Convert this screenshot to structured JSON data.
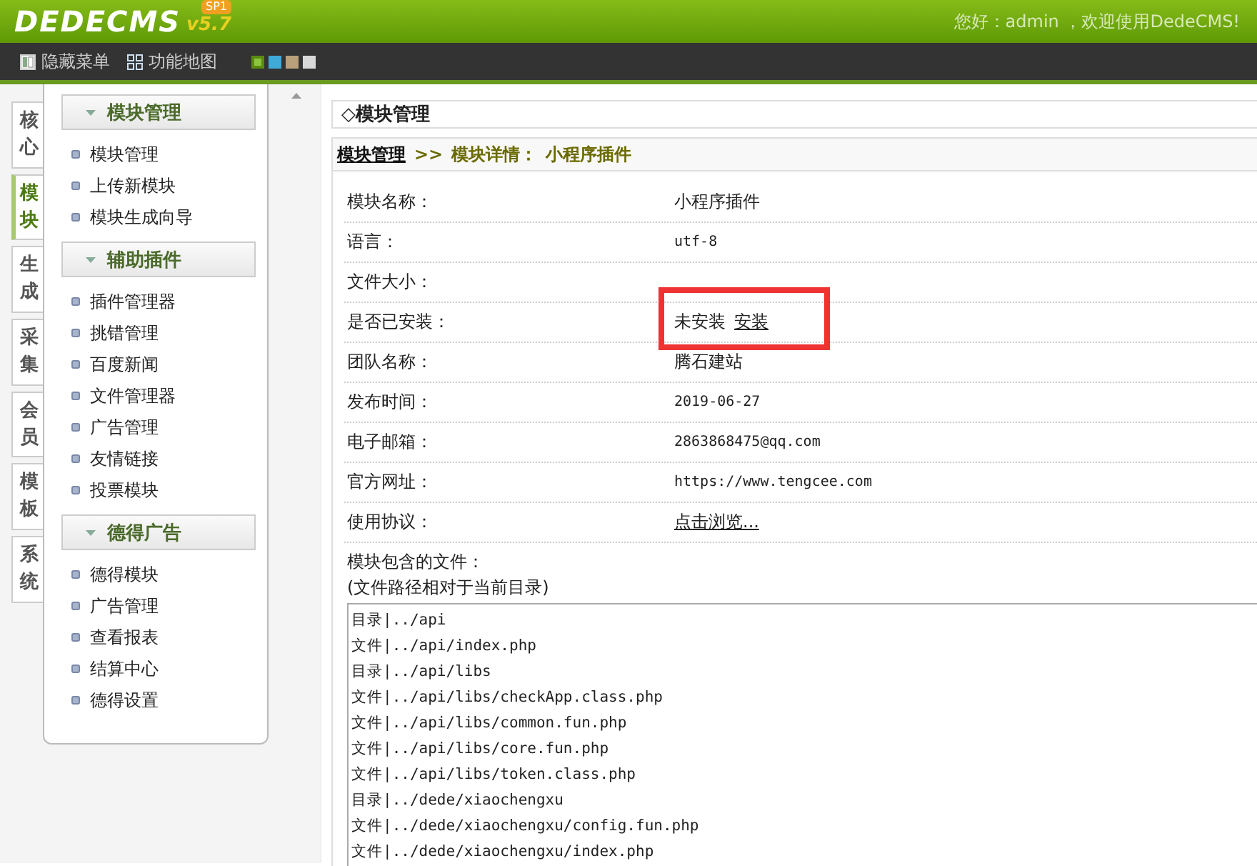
{
  "header": {
    "logo": "DEDECMS",
    "version": "v5.7",
    "badge": "SP1",
    "greeting": "您好：admin ，欢迎使用DedeCMS!"
  },
  "toolbar": {
    "buttons": [
      {
        "label": "隐藏菜单",
        "kind": "panel"
      },
      {
        "label": "功能地图",
        "kind": "grid"
      }
    ],
    "swatches": [
      {
        "color": "#8cc63f",
        "selected": true
      },
      {
        "color": "#3fa9d8",
        "selected": false
      },
      {
        "color": "#b8a07a",
        "selected": false
      },
      {
        "color": "#d8d8d8",
        "selected": false
      }
    ]
  },
  "side_tabs": [
    {
      "label": "核心",
      "selected": false
    },
    {
      "label": "模块",
      "selected": true
    },
    {
      "label": "生成",
      "selected": false
    },
    {
      "label": "采集",
      "selected": false
    },
    {
      "label": "会员",
      "selected": false
    },
    {
      "label": "模板",
      "selected": false
    },
    {
      "label": "系统",
      "selected": false
    }
  ],
  "menu": [
    {
      "title": "模块管理",
      "items": [
        "模块管理",
        "上传新模块",
        "模块生成向导"
      ]
    },
    {
      "title": "辅助插件",
      "items": [
        "插件管理器",
        "挑错管理",
        "百度新闻",
        "文件管理器",
        "广告管理",
        "友情链接",
        "投票模块"
      ]
    },
    {
      "title": "德得广告",
      "items": [
        "德得模块",
        "广告管理",
        "查看报表",
        "结算中心",
        "德得设置"
      ]
    }
  ],
  "main": {
    "title": "◇模块管理",
    "breadcrumb": {
      "link": "模块管理",
      "separator": ">>",
      "detail": "模块详情：",
      "name": "小程序插件"
    },
    "fields": [
      {
        "label": "模块名称：",
        "value": "小程序插件",
        "kind": "text"
      },
      {
        "label": "语言：",
        "value": "utf-8",
        "kind": "mono"
      },
      {
        "label": "文件大小："
      },
      {
        "label": "是否已安装：",
        "value": "未安装",
        "link": "安装",
        "kind": "text"
      },
      {
        "label": "团队名称：",
        "value": "腾石建站",
        "kind": "text"
      },
      {
        "label": "发布时间：",
        "value": "2019-06-27",
        "kind": "mono"
      },
      {
        "label": "电子邮箱：",
        "value": "2863868475@qq.com",
        "kind": "mono"
      },
      {
        "label": "官方网址：",
        "value": "https://www.tengcee.com",
        "kind": "mono"
      },
      {
        "label": "使用协议：",
        "link": "点击浏览..."
      }
    ],
    "files_label": "模块包含的文件：",
    "files_note": "(文件路径相对于当前目录)",
    "files": [
      "目录|../api",
      "文件|../api/index.php",
      "目录|../api/libs",
      "文件|../api/libs/checkApp.class.php",
      "文件|../api/libs/common.fun.php",
      "文件|../api/libs/core.fun.php",
      "文件|../api/libs/token.class.php",
      "目录|../dede/xiaochengxu",
      "文件|../dede/xiaochengxu/config.fun.php",
      "文件|../dede/xiaochengxu/index.php"
    ]
  }
}
